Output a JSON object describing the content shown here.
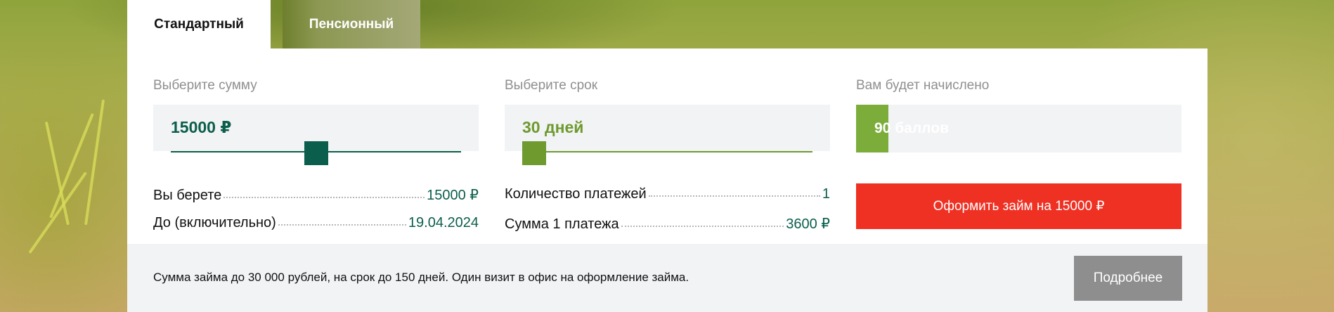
{
  "tabs": [
    {
      "label": "Стандартный",
      "active": true
    },
    {
      "label": "Пенсионный",
      "active": false
    }
  ],
  "amount": {
    "label": "Выберите сумму",
    "value": "15000 ₽",
    "slider_fraction": 0.5,
    "color": "#0b5e4c"
  },
  "term": {
    "label": "Выберите срок",
    "value": "30 дней",
    "slider_fraction": 0.0,
    "color": "#6e9a2e"
  },
  "points": {
    "label": "Вам будет начислено",
    "value": "90 баллов",
    "fill_fraction": 0.1,
    "color": "#7cad3a"
  },
  "summary_left": [
    {
      "label": "Вы берете",
      "value": "15000 ₽"
    },
    {
      "label": "До (включительно)",
      "value": "19.04.2024"
    }
  ],
  "summary_mid": [
    {
      "label": "Количество платежей",
      "value": "1"
    },
    {
      "label": "Сумма 1 платежа",
      "value": "3600 ₽"
    }
  ],
  "apply_button": {
    "label": "Оформить займ на 15000 ₽",
    "color": "#ef3124"
  },
  "footer": {
    "text": "Сумма займа до 30 000 рублей, на срок до 150 дней. Один визит в офис на оформление займа.",
    "more_button": "Подробнее"
  }
}
